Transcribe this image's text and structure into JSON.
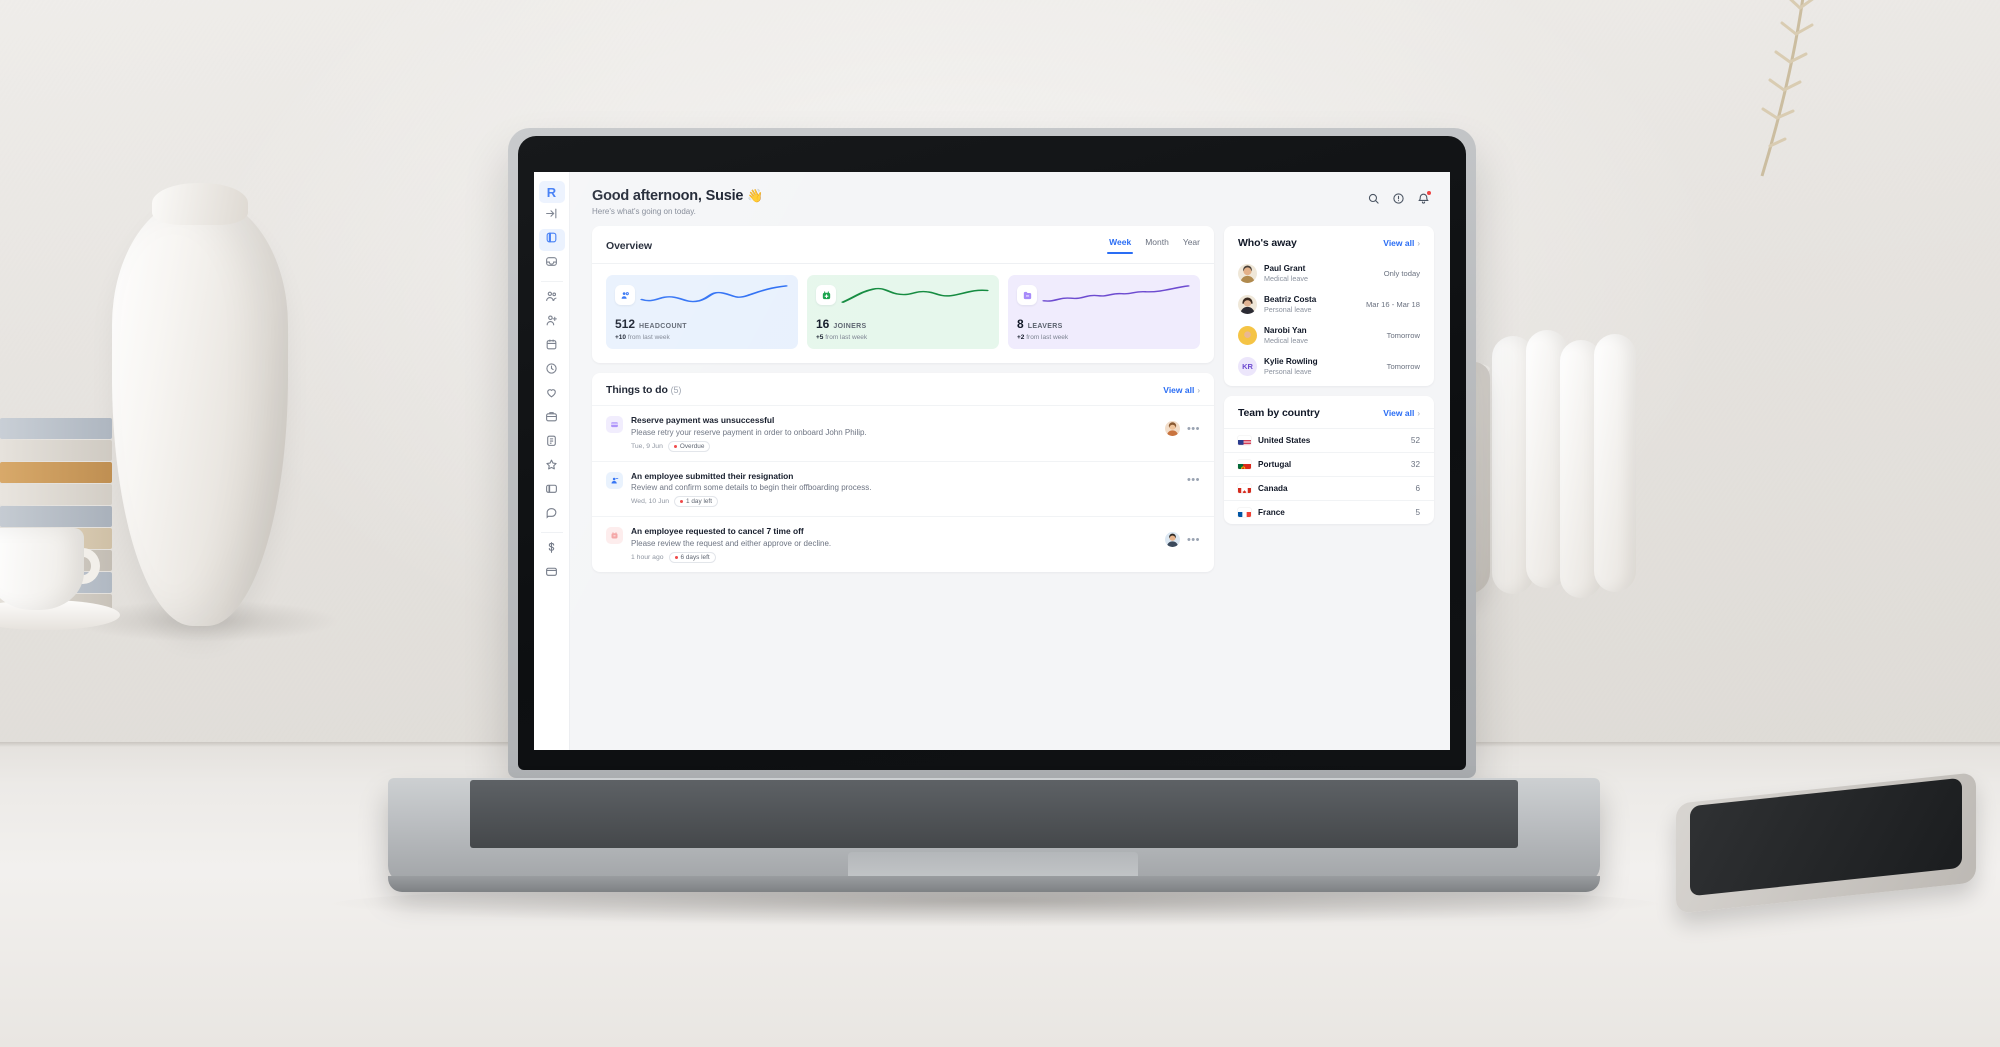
{
  "app": {
    "logo_letter": "R",
    "accent": "#2a6df4",
    "bg": "#f4f5f7"
  },
  "sidebar": {
    "items": [
      {
        "icon": "remote-logo-icon",
        "label": "Remote",
        "active": false,
        "logo": true
      },
      {
        "icon": "collapse-sidebar-icon",
        "label": "Collapse sidebar",
        "active": false
      },
      {
        "icon": "dashboard-icon",
        "label": "Dashboard",
        "active": true
      },
      {
        "icon": "inbox-icon",
        "label": "Inbox",
        "active": false
      },
      {
        "icon": "people-icon",
        "label": "People",
        "active": false
      },
      {
        "icon": "add-person-icon",
        "label": "Hire",
        "active": false
      },
      {
        "icon": "calendar-icon",
        "label": "Calendar",
        "active": false
      },
      {
        "icon": "clock-icon",
        "label": "Time tracking",
        "active": false
      },
      {
        "icon": "heart-icon",
        "label": "Benefits",
        "active": false
      },
      {
        "icon": "briefcase-icon",
        "label": "Jobs",
        "active": false
      },
      {
        "icon": "documents-icon",
        "label": "Documents",
        "active": false
      },
      {
        "icon": "star-icon",
        "label": "Performance",
        "active": false
      },
      {
        "icon": "payroll-icon",
        "label": "Payroll",
        "active": false
      },
      {
        "icon": "chat-icon",
        "label": "Support",
        "active": false
      },
      {
        "icon": "dollar-icon",
        "label": "Billing",
        "active": false
      },
      {
        "icon": "wallet-icon",
        "label": "Expenses",
        "active": false
      }
    ]
  },
  "header": {
    "greeting": "Good afternoon, Susie",
    "wave_emoji": "👋",
    "subtitle": "Here's what's going on today.",
    "icons": [
      {
        "name": "search-icon",
        "badge": false
      },
      {
        "name": "help-icon",
        "badge": false
      },
      {
        "name": "notifications-bell-icon",
        "badge": true
      }
    ]
  },
  "overview": {
    "title": "Overview",
    "tabs": [
      {
        "label": "Week",
        "active": true
      },
      {
        "label": "Month",
        "active": false
      },
      {
        "label": "Year",
        "active": false
      }
    ],
    "stats": [
      {
        "value": "512",
        "label": "HEADCOUNT",
        "delta": "+10",
        "delta_text": "from last week",
        "tone": "blue",
        "icon": "people-icon",
        "accent": "#2a6df4",
        "bg": "#e8f1fd"
      },
      {
        "value": "16",
        "label": "JOINERS",
        "delta": "+5",
        "delta_text": "from last week",
        "tone": "green",
        "icon": "add-calendar-icon",
        "accent": "#16a34a",
        "bg": "#e6f7ec"
      },
      {
        "value": "8",
        "label": "LEAVERS",
        "delta": "+2",
        "delta_text": "from last week",
        "tone": "purple",
        "icon": "minus-folder-icon",
        "accent": "#7c5cf0",
        "bg": "#f0ecfd"
      }
    ]
  },
  "chart_data": {
    "type": "line",
    "title": "Overview sparklines",
    "xlabel": "",
    "ylabel": "",
    "grid": false,
    "legend": "none",
    "series": [
      {
        "name": "Headcount",
        "color": "#2a6df4",
        "values": [
          34,
          46,
          30,
          40,
          34,
          52,
          44,
          62,
          78
        ]
      },
      {
        "name": "Joiners",
        "color": "#16a34a",
        "values": [
          18,
          34,
          52,
          44,
          58,
          50,
          46,
          62,
          56
        ]
      },
      {
        "name": "Leavers",
        "color": "#7c5cf0",
        "values": [
          26,
          38,
          30,
          44,
          40,
          50,
          46,
          58,
          72
        ]
      }
    ]
  },
  "things_to_do": {
    "title": "Things to do",
    "count": "(5)",
    "view_all": "View all",
    "chevron": "›",
    "items": [
      {
        "icon": "card-payment-icon",
        "icon_tone": "purple",
        "title": "Reserve payment was unsuccessful",
        "desc": "Please retry your reserve payment in order to onboard John Philip.",
        "date": "Tue, 9 Jun",
        "badge": "Overdue",
        "has_avatar": true,
        "avatar_tone": "warm"
      },
      {
        "icon": "person-minus-icon",
        "icon_tone": "blue",
        "title": "An employee submitted their resignation",
        "desc": "Review and confirm some details to begin their offboarding process.",
        "date": "Wed, 10 Jun",
        "badge": "1 day left",
        "has_avatar": false,
        "avatar_tone": ""
      },
      {
        "icon": "calendar-cancel-icon",
        "icon_tone": "pink",
        "title": "An employee requested to cancel 7 time off",
        "desc": "Please review the request and either approve or decline.",
        "date": "1 hour ago",
        "badge": "6 days left",
        "has_avatar": true,
        "avatar_tone": "cool"
      }
    ]
  },
  "whos_away": {
    "title": "Who's away",
    "view_all": "View all",
    "chevron": "›",
    "people": [
      {
        "name": "Paul Grant",
        "leave": "Medical leave",
        "when": "Only today",
        "avatar": "photo-warm",
        "initials": ""
      },
      {
        "name": "Beatriz Costa",
        "leave": "Personal leave",
        "when": "Mar 16 - Mar 18",
        "avatar": "photo-dark",
        "initials": ""
      },
      {
        "name": "Narobi Yan",
        "leave": "Medical leave",
        "when": "Tomorrow",
        "avatar": "photo-yellow",
        "initials": ""
      },
      {
        "name": "Kylie Rowling",
        "leave": "Personal leave",
        "when": "Tomorrow",
        "avatar": "initials",
        "initials": "KR"
      }
    ]
  },
  "team_by_country": {
    "title": "Team by country",
    "view_all": "View all",
    "chevron": "›",
    "rows": [
      {
        "country": "United States",
        "value": "52",
        "flag": "us"
      },
      {
        "country": "Portugal",
        "value": "32",
        "flag": "pt"
      },
      {
        "country": "Canada",
        "value": "6",
        "flag": "ca"
      },
      {
        "country": "France",
        "value": "5",
        "flag": "fr"
      }
    ]
  }
}
